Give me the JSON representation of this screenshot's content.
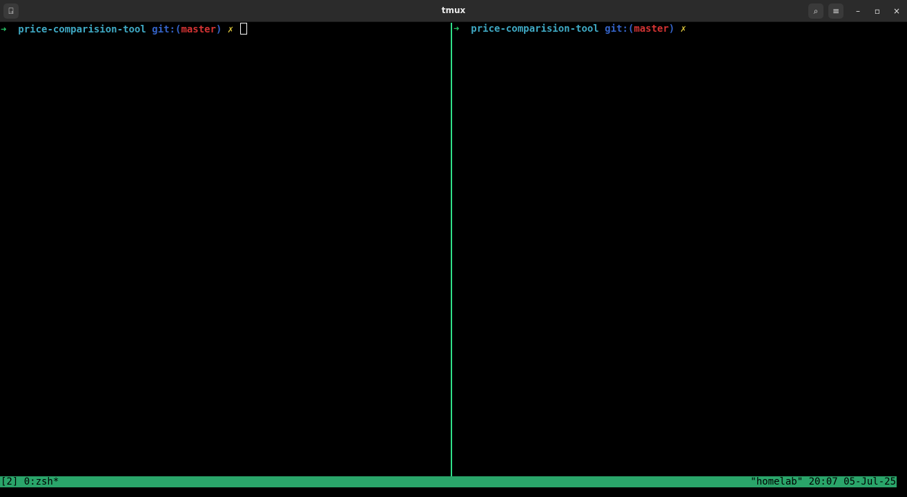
{
  "window": {
    "title": "tmux"
  },
  "titlebar_icons": {
    "new_tab": "terminal-tab-icon",
    "search": "search-icon",
    "menu": "hamburger-menu-icon",
    "minimize": "minimize-icon",
    "maximize": "maximize-icon",
    "close": "close-icon"
  },
  "glyphs": {
    "new_tab": "⍈",
    "search": "⌕",
    "menu": "≡",
    "minimize": "–",
    "maximize": "▫",
    "close": "×"
  },
  "panes": [
    {
      "arrow": "➜",
      "directory": "price-comparision-tool",
      "git_label": "git:(",
      "branch": "master",
      "git_close": ")",
      "dirty_mark": "✗",
      "active": true
    },
    {
      "arrow": "➜",
      "directory": "price-comparision-tool",
      "git_label": "git:(",
      "branch": "master",
      "git_close": ")",
      "dirty_mark": "✗",
      "active": false
    }
  ],
  "status": {
    "left": "[2] 0:zsh*",
    "right": "\"homelab\" 20:07 05-Jul-25"
  },
  "colors": {
    "background": "#000000",
    "status_bar": "#2aa56a",
    "active_border": "#2fe08a",
    "directory": "#3fa9c4",
    "git": "#3463c8",
    "branch": "#d43333",
    "dirty_mark": "#d8c23a",
    "arrow": "#27c266"
  }
}
